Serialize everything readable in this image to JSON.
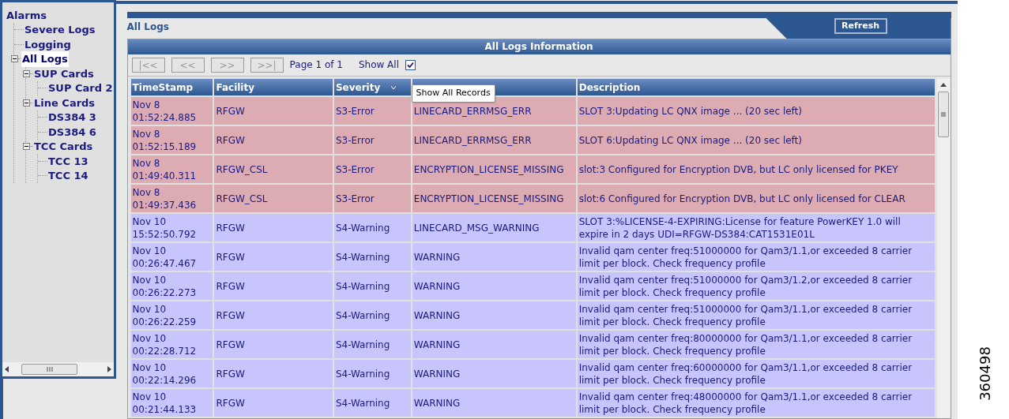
{
  "tree": [
    {
      "label": "Alarms",
      "selected": false,
      "children": [
        {
          "label": "Severe Logs",
          "selected": false
        },
        {
          "label": "Logging",
          "selected": false
        },
        {
          "label": "All Logs",
          "selected": true,
          "expanded": true,
          "children": [
            {
              "label": "SUP Cards",
              "selected": false,
              "expanded": true,
              "children": [
                {
                  "label": "SUP Card 2",
                  "selected": false
                }
              ]
            },
            {
              "label": "Line Cards",
              "selected": false,
              "expanded": true,
              "children": [
                {
                  "label": "DS384 3",
                  "selected": false
                },
                {
                  "label": "DS384 6",
                  "selected": false
                }
              ]
            },
            {
              "label": "TCC Cards",
              "selected": false,
              "expanded": true,
              "children": [
                {
                  "label": "TCC 13",
                  "selected": false
                },
                {
                  "label": "TCC 14",
                  "selected": false
                }
              ]
            }
          ]
        }
      ]
    }
  ],
  "page_title": "All Logs",
  "refresh_button": "Refresh",
  "panel_title": "All Logs Information",
  "pager": {
    "buttons": [
      {
        "label": "|<<",
        "disabled": true
      },
      {
        "label": "<<",
        "disabled": true
      },
      {
        "label": ">>",
        "disabled": true
      },
      {
        "label": ">>|",
        "disabled": true
      }
    ],
    "page_text": "Page 1 of 1",
    "show_all": {
      "label": "Show All",
      "checked": true
    }
  },
  "table": {
    "columns": [
      {
        "label": "TimeStamp"
      },
      {
        "label": "Facility"
      },
      {
        "label": "Severity",
        "sorted": true
      },
      {},
      {
        "label": "Description"
      }
    ],
    "tooltip": "Show All Records",
    "rows": [
      {
        "kind": "error",
        "cells": [
          "Nov 8 01:52:24.885",
          "RFGW",
          "S3-Error",
          "LINECARD_ERRMSG_ERR",
          "SLOT 3:Updating LC QNX image ... (20 sec left)"
        ]
      },
      {
        "kind": "error",
        "cells": [
          "Nov 8 01:52:15.189",
          "RFGW",
          "S3-Error",
          "LINECARD_ERRMSG_ERR",
          "SLOT 6:Updating LC QNX image ... (20 sec left)"
        ]
      },
      {
        "kind": "error",
        "cells": [
          "Nov 8 01:49:40.311",
          "RFGW_CSL",
          "S3-Error",
          "ENCRYPTION_LICENSE_MISSING",
          "slot:3 Configured for Encryption DVB, but LC only licensed for PKEY"
        ]
      },
      {
        "kind": "error",
        "cells": [
          "Nov 8 01:49:37.436",
          "RFGW_CSL",
          "S3-Error",
          "ENCRYPTION_LICENSE_MISSING",
          "slot:6 Configured for Encryption DVB, but LC only licensed for CLEAR"
        ]
      },
      {
        "kind": "warning",
        "cells": [
          "Nov 10 15:52:50.792",
          "RFGW",
          "S4-Warning",
          "LINECARD_MSG_WARNING",
          "SLOT 3:%LICENSE-4-EXPIRING:License for feature PowerKEY 1.0 will expire in 2 days UDI=RFGW-DS384:CAT1531E01L"
        ]
      },
      {
        "kind": "warning",
        "cells": [
          "Nov 10 00:26:47.467",
          "RFGW",
          "S4-Warning",
          "WARNING",
          "Invalid qam center freq:51000000 for Qam3/1.1,or exceeded 8 carrier limit per block. Check frequency profile"
        ]
      },
      {
        "kind": "warning",
        "cells": [
          "Nov 10 00:26:22.273",
          "RFGW",
          "S4-Warning",
          "WARNING",
          "Invalid qam center freq:51000000 for Qam3/1.2,or exceeded 8 carrier limit per block. Check frequency profile"
        ]
      },
      {
        "kind": "warning",
        "cells": [
          "Nov 10 00:26:22.259",
          "RFGW",
          "S4-Warning",
          "WARNING",
          "Invalid qam center freq:51000000 for Qam3/1.1,or exceeded 8 carrier limit per block. Check frequency profile"
        ]
      },
      {
        "kind": "warning",
        "cells": [
          "Nov 10 00:22:28.712",
          "RFGW",
          "S4-Warning",
          "WARNING",
          "Invalid qam center freq:80000000 for Qam3/1.1,or exceeded 8 carrier limit per block. Check frequency profile"
        ]
      },
      {
        "kind": "warning",
        "cells": [
          "Nov 10 00:22:14.296",
          "RFGW",
          "S4-Warning",
          "WARNING",
          "Invalid qam center freq:60000000 for Qam3/1.1,or exceeded 8 carrier limit per block. Check frequency profile"
        ]
      },
      {
        "kind": "warning",
        "cells": [
          "Nov 10 00:21:44.133",
          "RFGW",
          "S4-Warning",
          "WARNING",
          "Invalid qam center freq:48000000 for Qam3/1.1,or exceeded 8 carrier limit per block. Check frequency profile"
        ]
      }
    ]
  },
  "figure_number": "360498"
}
